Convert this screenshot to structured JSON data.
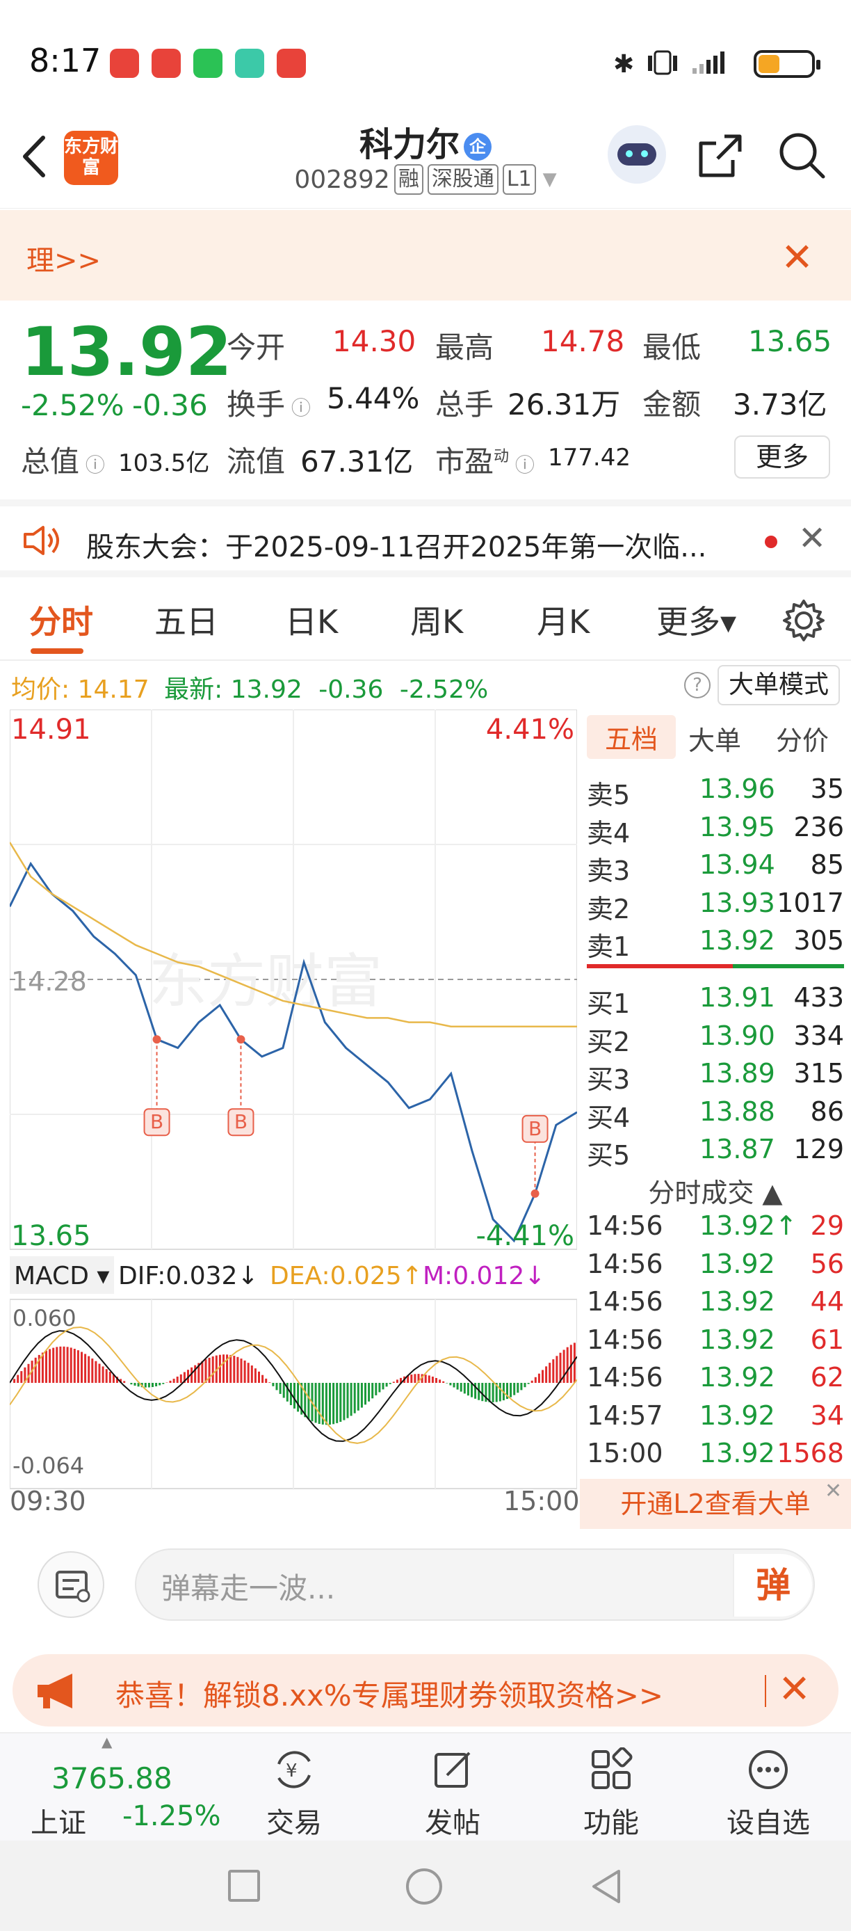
{
  "status_bar": {
    "time": "8:17"
  },
  "header": {
    "logo_text": "东方财富",
    "stock_name": "科力尔",
    "badge": "企",
    "stock_code": "002892",
    "tags": [
      "融",
      "深股通",
      "L1"
    ]
  },
  "banner": {
    "text": "理>>"
  },
  "quote": {
    "price": "13.92",
    "change_pct": "-2.52%",
    "change": "-0.36",
    "open_label": "今开",
    "open": "14.30",
    "high_label": "最高",
    "high": "14.78",
    "low_label": "最低",
    "low": "13.65",
    "turnover_label": "换手",
    "turnover": "5.44%",
    "volume_label": "总手",
    "volume": "26.31万",
    "amount_label": "金额",
    "amount": "3.73亿",
    "total_value_label": "总值",
    "total_value": "103.5亿",
    "float_value_label": "流值",
    "float_value": "67.31亿",
    "pe_label": "市盈",
    "pe_sup": "动",
    "pe": "177.42",
    "more": "更多"
  },
  "notice": {
    "text": "股东大会：于2025-09-11召开2025年第一次临..."
  },
  "tabs": [
    "分时",
    "五日",
    "日K",
    "周K",
    "月K",
    "更多▾"
  ],
  "info_line": {
    "avg_label": "均价:",
    "avg": "14.17",
    "latest_label": "最新:",
    "latest": "13.92",
    "change": "-0.36",
    "pct": "-2.52%",
    "mode_button": "大单模式"
  },
  "chart": {
    "y_max": "14.91",
    "y_mid": "14.28",
    "y_min": "13.65",
    "pct_max": "4.41%",
    "pct_min": "-4.41%",
    "x_start": "09:30",
    "x_end": "15:00",
    "watermark": "东方财富",
    "buy_marker": "B",
    "macd_label": "MACD ▾",
    "dif": "DIF:0.032↓",
    "dea": "DEA:0.025↑",
    "m": "M:0.012↓",
    "macd_max": "0.060",
    "macd_min": "-0.064",
    "colors": {
      "price_line": "#2c64a8",
      "avg_line": "#e8b84a",
      "up": "#e02a2a",
      "down": "#1a9a3a"
    }
  },
  "chart_data": {
    "type": "line",
    "title": "",
    "xlabel": "",
    "ylabel": "",
    "x": [
      "09:30",
      "15:00"
    ],
    "ylim": [
      13.65,
      14.91
    ],
    "series": [
      {
        "name": "",
        "values": [
          14.45,
          14.55,
          14.48,
          14.44,
          14.38,
          14.34,
          14.29,
          14.14,
          14.12,
          14.18,
          14.22,
          14.14,
          14.1,
          14.12,
          14.32,
          14.18,
          14.12,
          14.08,
          14.04,
          13.98,
          14.0,
          14.06,
          13.88,
          13.72,
          13.67,
          13.78,
          13.94,
          13.97
        ]
      },
      {
        "name": "均价",
        "values": [
          14.6,
          14.52,
          14.48,
          14.45,
          14.42,
          14.39,
          14.36,
          14.34,
          14.32,
          14.31,
          14.29,
          14.27,
          14.25,
          14.23,
          14.22,
          14.21,
          14.2,
          14.19,
          14.19,
          14.18,
          14.18,
          14.17,
          14.17,
          14.17,
          14.17,
          14.17,
          14.17,
          14.17
        ]
      }
    ]
  },
  "orderbook": {
    "tabs": [
      "五档",
      "大单",
      "分价"
    ],
    "sells": [
      {
        "label": "卖5",
        "price": "13.96",
        "vol": "35"
      },
      {
        "label": "卖4",
        "price": "13.95",
        "vol": "236"
      },
      {
        "label": "卖3",
        "price": "13.94",
        "vol": "85"
      },
      {
        "label": "卖2",
        "price": "13.93",
        "vol": "1017"
      },
      {
        "label": "卖1",
        "price": "13.92",
        "vol": "305"
      }
    ],
    "buys": [
      {
        "label": "买1",
        "price": "13.91",
        "vol": "433"
      },
      {
        "label": "买2",
        "price": "13.90",
        "vol": "334"
      },
      {
        "label": "买3",
        "price": "13.89",
        "vol": "315"
      },
      {
        "label": "买4",
        "price": "13.88",
        "vol": "86"
      },
      {
        "label": "买5",
        "price": "13.87",
        "vol": "129"
      }
    ],
    "ticks_title": "分时成交 ▲",
    "ticks": [
      {
        "time": "14:56",
        "price": "13.92↑",
        "vol": "29"
      },
      {
        "time": "14:56",
        "price": "13.92",
        "vol": "56"
      },
      {
        "time": "14:56",
        "price": "13.92",
        "vol": "44"
      },
      {
        "time": "14:56",
        "price": "13.92",
        "vol": "61"
      },
      {
        "time": "14:56",
        "price": "13.92",
        "vol": "62"
      },
      {
        "time": "14:57",
        "price": "13.92",
        "vol": "34"
      },
      {
        "time": "15:00",
        "price": "13.92",
        "vol": "1568"
      }
    ],
    "l2_button": "开通L2查看大单"
  },
  "comment": {
    "placeholder": "弹幕走一波...",
    "dan": "弹"
  },
  "promo": {
    "text": "恭喜！解锁8.xx%专属理财券领取资格>>"
  },
  "bottom_nav": {
    "index_value": "3765.88",
    "index_name": "上证",
    "index_change": "-1.25%",
    "items": [
      "交易",
      "发帖",
      "功能",
      "设自选"
    ]
  }
}
